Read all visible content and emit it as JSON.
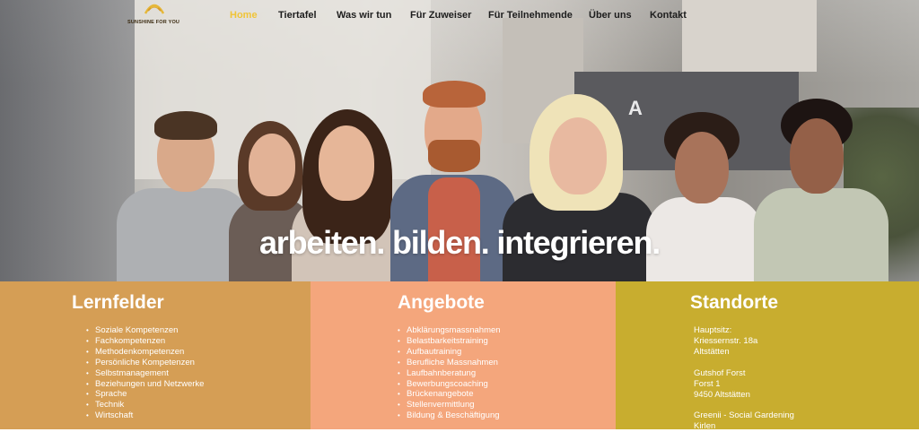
{
  "brand": {
    "logo_text": "SUNSHINE FOR YOU",
    "accent": "#f0c437"
  },
  "nav": {
    "items": [
      {
        "label": "Home",
        "active": true
      },
      {
        "label": "Tiertafel",
        "active": false
      },
      {
        "label": "Was wir tun",
        "active": false
      },
      {
        "label": "Für Zuweiser",
        "active": false
      },
      {
        "label": "Für Teilnehmende",
        "active": false
      },
      {
        "label": "Über uns",
        "active": false
      },
      {
        "label": "Kontakt",
        "active": false
      }
    ]
  },
  "hero": {
    "tagline": "arbeiten. bilden. integrieren.",
    "sign_letter": "A"
  },
  "lernfelder": {
    "title": "Lernfelder",
    "color": "#d59e55",
    "items": [
      "Soziale Kompetenzen",
      "Fachkompetenzen",
      "Methodenkompetenzen",
      "Persönliche Kompetenzen",
      "Selbstmanagement",
      "Beziehungen und Netzwerke",
      "Sprache",
      "Technik",
      "Wirtschaft"
    ]
  },
  "angebote": {
    "title": "Angebote",
    "color": "#f4a67c",
    "items": [
      "Abklärungsmassnahmen",
      "Belastbarkeitstraining",
      "Aufbautraining",
      "Berufliche Massnahmen",
      "Laufbahnberatung",
      "Bewerbungscoaching",
      "Brückenangebote",
      "Stellenvermittlung",
      "Bildung & Beschäftigung"
    ]
  },
  "standorte": {
    "title": "Standorte",
    "color": "#c8ad2f",
    "blocks": [
      [
        "Hauptsitz:",
        "Kriessernstr. 18a",
        "Altstätten"
      ],
      [
        "Gutshof Forst",
        "Forst 1",
        "9450 Altstätten"
      ],
      [
        "Greenii - Social Gardening",
        "Kirlen"
      ]
    ]
  }
}
